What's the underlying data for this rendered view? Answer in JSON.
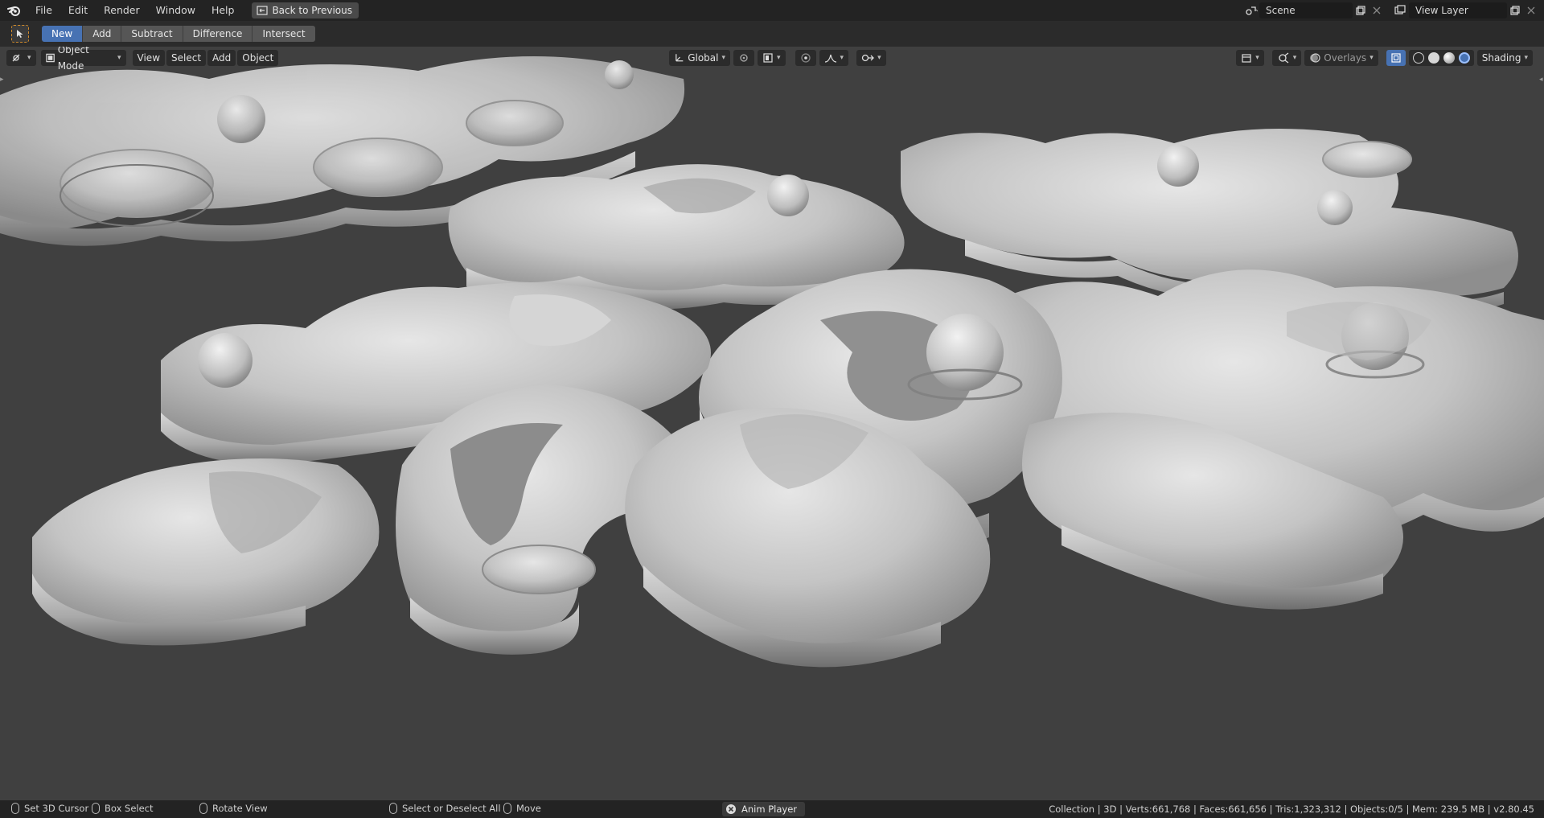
{
  "menu": {
    "items": [
      "File",
      "Edit",
      "Render",
      "Window",
      "Help"
    ],
    "back_label": "Back to Previous"
  },
  "top_right": {
    "scene_name": "Scene",
    "view_layer_name": "View Layer"
  },
  "tool_header": {
    "boolean_ops": [
      "New",
      "Add",
      "Subtract",
      "Difference",
      "Intersect"
    ],
    "active_op": "New"
  },
  "viewport_header": {
    "mode": "Object Mode",
    "menus": [
      "View",
      "Select",
      "Add",
      "Object"
    ],
    "transform_orientation": "Global",
    "overlays_label": "Overlays",
    "shading_label": "Shading"
  },
  "status_bar": {
    "hints": [
      {
        "label": "Set 3D Cursor",
        "icon": "mouse-left-icon"
      },
      {
        "label": "Box Select",
        "icon": "mouse-drag-icon"
      },
      {
        "label": "Rotate View",
        "icon": "mouse-middle-icon"
      },
      {
        "label": "Select or Deselect All",
        "icon": "mouse-left-icon"
      },
      {
        "label": "Move",
        "icon": "mouse-drag-icon"
      }
    ],
    "anim_player": "Anim Player",
    "stats": "Collection | 3D | Verts:661,768 | Faces:661,656 | Tris:1,323,312 | Objects:0/5 | Mem: 239.5 MB | v2.80.45"
  },
  "colors": {
    "accent": "#4772b3",
    "viewport_bg": "#404040",
    "mesh_base": "#c4c4c4",
    "header_bg": "#232323"
  }
}
